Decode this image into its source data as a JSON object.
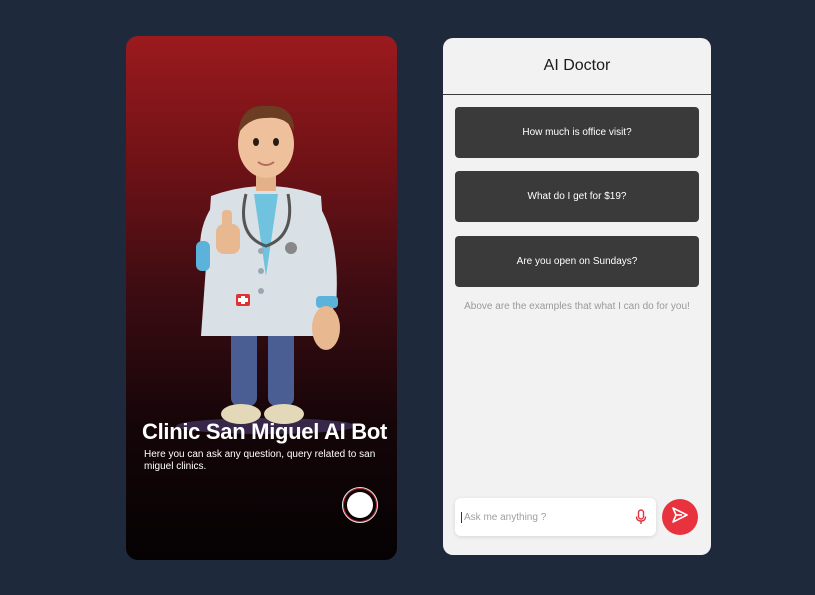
{
  "promo": {
    "title": "Clinic San Miguel AI Bot",
    "subtitle": "Here you can ask any question, query related to san miguel clinics.",
    "illustration": "doctor-character-illustration",
    "record_icon": "record-icon"
  },
  "chat": {
    "title": "AI Doctor",
    "suggestions": [
      {
        "label": "How much is office visit?"
      },
      {
        "label": "What do I get for $19?"
      },
      {
        "label": "Are you open on Sundays?"
      }
    ],
    "hint": "Above are the examples that what I can do for you!",
    "input": {
      "placeholder": "Ask me anything ?",
      "value": ""
    },
    "mic_icon": "microphone-icon",
    "send_icon": "send-icon"
  },
  "colors": {
    "background": "#1e293b",
    "accent": "#e8333f",
    "suggestion_bg": "#3a3a3a",
    "promo_top": "#9b1a1e"
  }
}
